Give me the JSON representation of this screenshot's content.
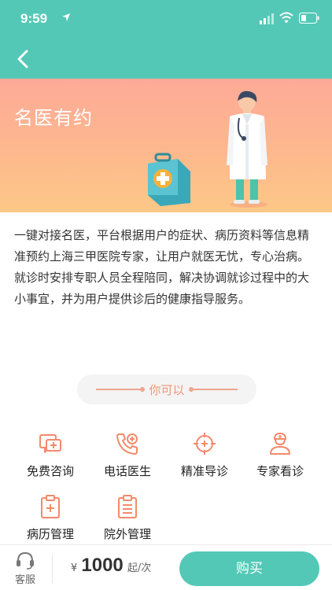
{
  "status": {
    "time": "9:59"
  },
  "banner": {
    "title": "名医有约"
  },
  "description": {
    "p1": "一键对接名医，平台根据用户的症状、病历资料等信息精准预约上海三甲医院专家，让用户就医无忧，专心治病。",
    "p2": "就诊时安排专职人员全程陪同，解决协调就诊过程中的大小事宜，并为用户提供诊后的健康指导服务。"
  },
  "section": {
    "label": "你可以"
  },
  "features": [
    {
      "label": "免费咨询",
      "icon": "chat-plus-icon"
    },
    {
      "label": "电话医生",
      "icon": "phone-plus-icon"
    },
    {
      "label": "精准导诊",
      "icon": "target-plus-icon"
    },
    {
      "label": "专家看诊",
      "icon": "doctor-icon"
    },
    {
      "label": "病历管理",
      "icon": "clipboard-plus-icon"
    },
    {
      "label": "院外管理",
      "icon": "clipboard-lines-icon"
    }
  ],
  "bottom": {
    "service_label": "客服",
    "currency": "¥",
    "price": "1000",
    "unit": "起/次",
    "buy_label": "购买"
  },
  "colors": {
    "primary": "#54c8b6",
    "accent": "#f0957a",
    "icon": "#f28a6c"
  }
}
